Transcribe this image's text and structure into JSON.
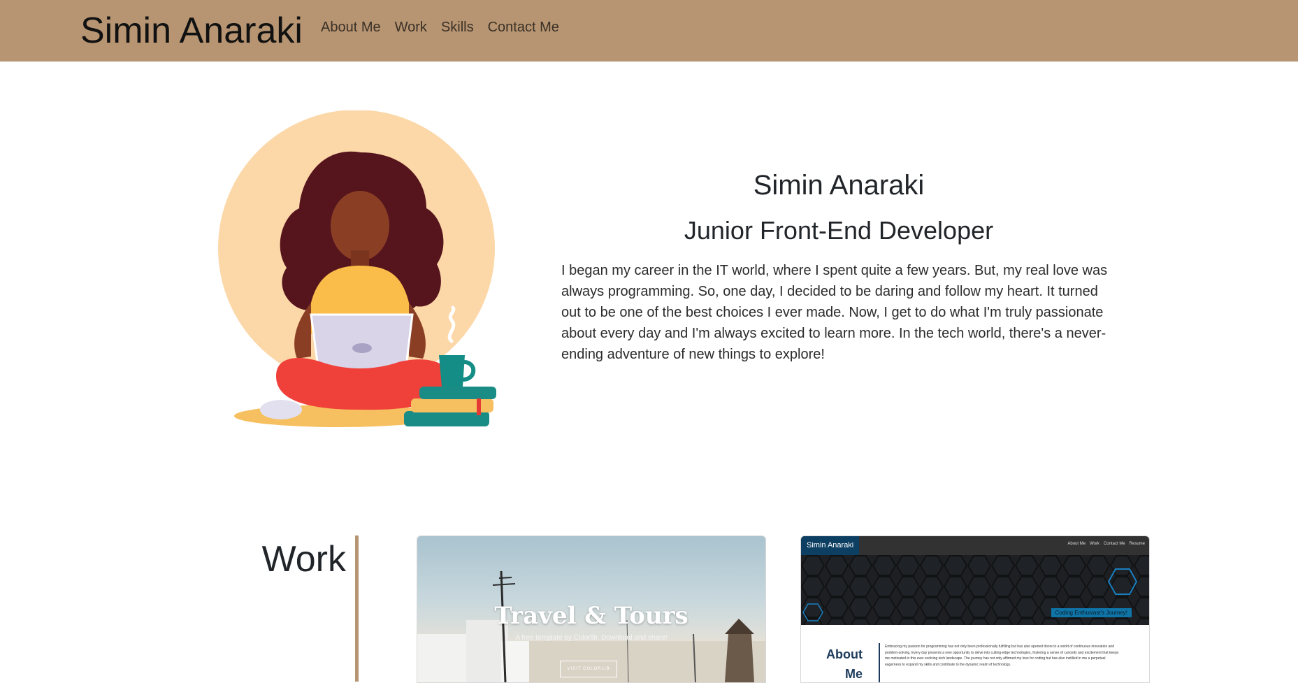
{
  "navbar": {
    "brand": "Simin Anaraki",
    "links": [
      "About Me",
      "Work",
      "Skills",
      "Contact Me"
    ]
  },
  "hero": {
    "name": "Simin Anaraki",
    "role": "Junior Front-End Developer",
    "bio": "I began my career in the IT world, where I spent quite a few years. But, my real love was always programming. So, one day, I decided to be daring and follow my heart. It turned out to be one of the best choices I ever made. Now, I get to do what I'm truly passionate about every day and I'm always excited to learn more. In the tech world, there's a never-ending adventure of new things to explore!"
  },
  "work": {
    "heading": "Work",
    "cards": [
      {
        "title": "Travel & Tours",
        "subtitle": "A free template by Colorlib. Download and share!",
        "button": "VISIT COLORLIB"
      },
      {
        "brand": "Simin Anaraki",
        "links": [
          "About Me",
          "Work",
          "Contact Me",
          "Resume"
        ],
        "badge": "Coding Enthusiast's Journey!",
        "about_title": "About Me",
        "about_text": "Embracing my passion for programming has not only been professionally fulfilling but has also opened doors to a world of continuous innovation and problem-solving. Every day presents a new opportunity to delve into cutting-edge technologies, fostering a sense of curiosity and excitement that keeps me motivated in this ever evolving tech landscape. The journey has not only affirmed my love for coding but has also instilled in me a perpetual eagerness to expand my skills and contribute to the dynamic realm of technology."
      }
    ]
  },
  "colors": {
    "navbar_bg": "#b79572",
    "accent": "#b79572",
    "text": "#212529",
    "illustration_circle": "#fcd7a8"
  }
}
